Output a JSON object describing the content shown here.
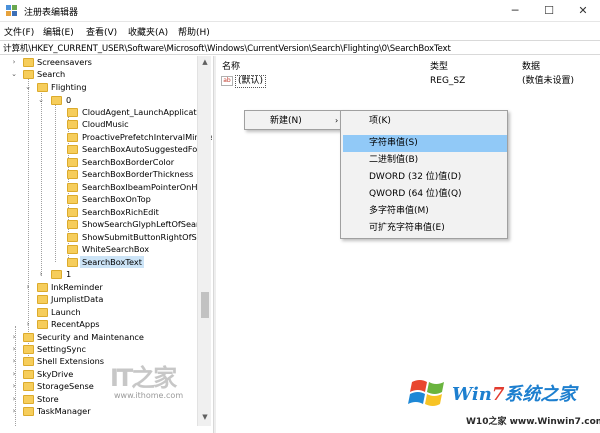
{
  "window": {
    "title": "注册表编辑器",
    "min_symbol": "─",
    "max_symbol": "☐",
    "close_symbol": "✕"
  },
  "menu": [
    "文件(F)",
    "编辑(E)",
    "查看(V)",
    "收藏夹(A)",
    "帮助(H)"
  ],
  "address": "计算机\\HKEY_CURRENT_USER\\Software\\Microsoft\\Windows\\CurrentVersion\\Search\\Flighting\\0\\SearchBoxText",
  "tree": {
    "items": [
      {
        "label": "Screensavers",
        "expander": "›"
      },
      {
        "label": "Search",
        "expander": "⌄"
      },
      {
        "label": "Flighting",
        "expander": "⌄"
      },
      {
        "label": "0",
        "expander": "⌄"
      },
      {
        "label": "CloudAgent_LaunchApplication",
        "expander": ""
      },
      {
        "label": "CloudMusic",
        "expander": ""
      },
      {
        "label": "ProactivePrefetchIntervalMinute",
        "expander": ""
      },
      {
        "label": "SearchBoxAutoSuggestedFore",
        "expander": ""
      },
      {
        "label": "SearchBoxBorderColor",
        "expander": ""
      },
      {
        "label": "SearchBoxBorderThickness",
        "expander": ""
      },
      {
        "label": "SearchBoxIbeamPointerOnHov",
        "expander": ""
      },
      {
        "label": "SearchBoxOnTop",
        "expander": ""
      },
      {
        "label": "SearchBoxRichEdit",
        "expander": ""
      },
      {
        "label": "ShowSearchGlyphLeftOfSearch",
        "expander": ""
      },
      {
        "label": "ShowSubmitButtonRightOfSear",
        "expander": ""
      },
      {
        "label": "WhiteSearchBox",
        "expander": ""
      },
      {
        "label": "SearchBoxText",
        "expander": "",
        "selected": true
      },
      {
        "label": "1",
        "expander": "›"
      },
      {
        "label": "InkReminder",
        "expander": "›"
      },
      {
        "label": "JumplistData",
        "expander": ""
      },
      {
        "label": "Launch",
        "expander": ""
      },
      {
        "label": "RecentApps",
        "expander": "›"
      },
      {
        "label": "Security and Maintenance",
        "expander": "›"
      },
      {
        "label": "SettingSync",
        "expander": "›"
      },
      {
        "label": "Shell Extensions",
        "expander": "›"
      },
      {
        "label": "SkyDrive",
        "expander": "›"
      },
      {
        "label": "StorageSense",
        "expander": "›"
      },
      {
        "label": "Store",
        "expander": "›"
      },
      {
        "label": "TaskManager",
        "expander": "›"
      }
    ]
  },
  "columns": {
    "name": "名称",
    "type": "类型",
    "data": "数据"
  },
  "value": {
    "icon": "ab",
    "name": "(默认)",
    "type": "REG_SZ",
    "data": "(数值未设置)"
  },
  "context_menu": {
    "new_label": "新建(N)",
    "arrow": "›",
    "submenu": [
      "项(K)",
      "字符串值(S)",
      "二进制值(B)",
      "DWORD (32 位)值(D)",
      "QWORD (64 位)值(Q)",
      "多字符串值(M)",
      "可扩充字符串值(E)"
    ],
    "highlighted": "字符串值(S)"
  },
  "watermarks": {
    "ithome_logo": "IT之家",
    "ithome_url": "www.ithome.com",
    "win7_brand_a": "Win",
    "win7_brand_b": "7",
    "win7_brand_c": "系统之家",
    "win7_site": "W10之家 www.Winwin7.com"
  },
  "colors": {
    "selection": "#cce4f7",
    "menu_highlight": "#91c9f7",
    "folder": "#f6cd5b"
  }
}
